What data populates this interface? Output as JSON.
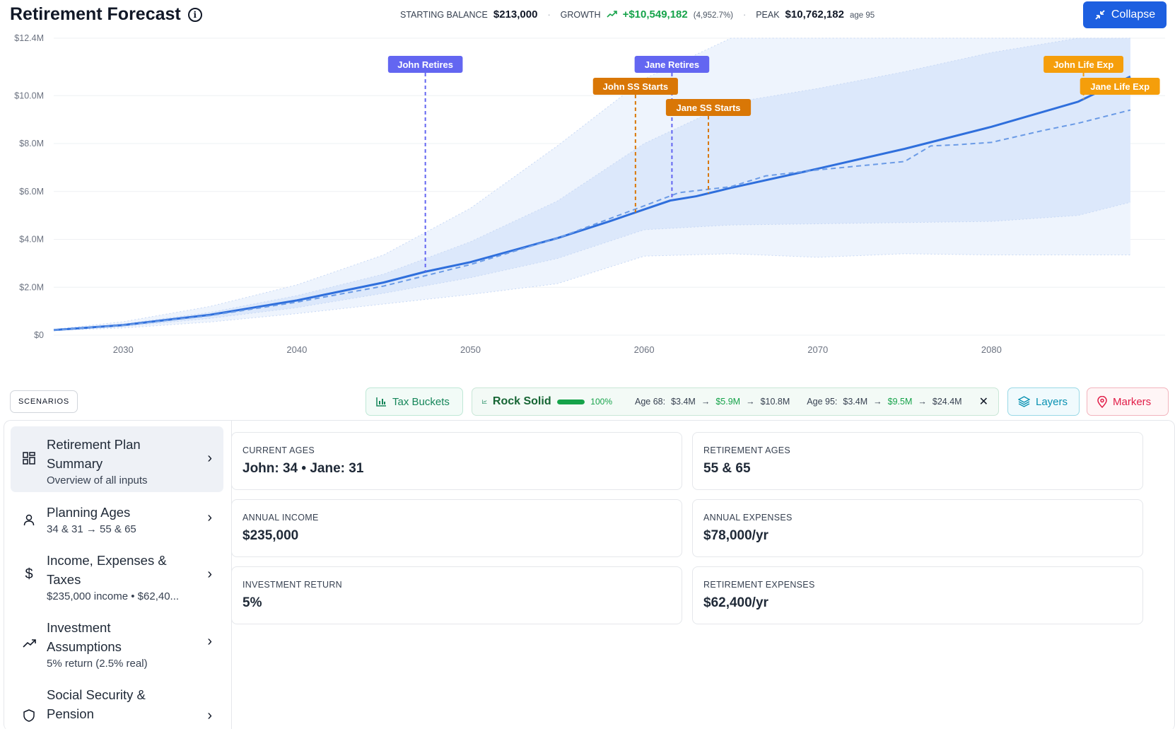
{
  "header": {
    "title": "Retirement Forecast",
    "starting_balance_label": "STARTING BALANCE",
    "starting_balance": "$213,000",
    "growth_label": "GROWTH",
    "growth_value": "+$10,549,182",
    "growth_pct": "(4,952.7%)",
    "peak_label": "PEAK",
    "peak_value": "$10,762,182",
    "peak_age": "age 95",
    "collapse_label": "Collapse"
  },
  "colors": {
    "accent": "#1d5fe0",
    "main_line": "#2f6fdc",
    "band_outer": "#eef4fd",
    "band_inner": "#dce8fb",
    "retire_marker": "#6366f1",
    "ss_marker": "#d97706",
    "life_marker": "#f59e0b",
    "green": "#16a34a"
  },
  "chart_data": {
    "type": "area",
    "ylim": [
      0,
      12400000
    ],
    "xlim": [
      2026,
      2090
    ],
    "y_ticks": [
      "$0",
      "$2.0M",
      "$4.0M",
      "$6.0M",
      "$8.0M",
      "$10.0M",
      "$12.4M"
    ],
    "y_tick_values": [
      0,
      2000000,
      4000000,
      6000000,
      8000000,
      10000000,
      12400000
    ],
    "x_ticks": [
      "2030",
      "2040",
      "2050",
      "2060",
      "2070",
      "2080"
    ],
    "x_tick_values": [
      2030,
      2040,
      2050,
      2060,
      2070,
      2080
    ],
    "series": [
      {
        "name": "",
        "style": "solid",
        "x": [
          2026,
          2030,
          2035,
          2040,
          2045,
          2047.4,
          2050,
          2055,
          2058,
          2060,
          2061.5,
          2063,
          2065,
          2070,
          2075,
          2080,
          2085,
          2088
        ],
        "values": [
          213000,
          420000,
          850000,
          1450000,
          2200000,
          2650000,
          3050000,
          4050000,
          4750000,
          5250000,
          5620000,
          5800000,
          6150000,
          6950000,
          7780000,
          8700000,
          9750000,
          10800000
        ]
      },
      {
        "name": "",
        "style": "dashed",
        "x": [
          2026,
          2030,
          2035,
          2040,
          2045,
          2050,
          2055,
          2060,
          2062,
          2065,
          2067,
          2070,
          2075,
          2076.5,
          2078,
          2080,
          2083,
          2085,
          2088
        ],
        "values": [
          213000,
          410000,
          820000,
          1380000,
          2050000,
          2950000,
          4050000,
          5400000,
          5950000,
          6200000,
          6650000,
          6900000,
          7250000,
          7900000,
          7950000,
          8050000,
          8550000,
          8850000,
          9400000
        ]
      }
    ],
    "bands": [
      {
        "name": "",
        "x": [
          2026,
          2030,
          2035,
          2040,
          2045,
          2050,
          2055,
          2060,
          2065,
          2070,
          2075,
          2080,
          2085,
          2088
        ],
        "upper": [
          240000,
          560000,
          1200000,
          2100000,
          3350000,
          5300000,
          7900000,
          10700000,
          12400000,
          12400000,
          12400000,
          12400000,
          12400000,
          12400000
        ],
        "lower": [
          200000,
          300000,
          550000,
          900000,
          1300000,
          1700000,
          2150000,
          3300000,
          3400000,
          3250000,
          3400000,
          3350000,
          3350000,
          3350000
        ]
      },
      {
        "name": "",
        "x": [
          2026,
          2030,
          2035,
          2040,
          2045,
          2050,
          2055,
          2060,
          2065,
          2070,
          2075,
          2080,
          2085,
          2088
        ],
        "upper": [
          225000,
          470000,
          950000,
          1650000,
          2550000,
          3900000,
          5600000,
          8000000,
          9700000,
          10300000,
          11000000,
          11800000,
          12400000,
          12400000
        ],
        "lower": [
          205000,
          360000,
          700000,
          1150000,
          1750000,
          2400000,
          3200000,
          4400000,
          4600000,
          4650000,
          4700000,
          4750000,
          5000000,
          5550000
        ]
      }
    ],
    "markers": [
      {
        "label": "John Retires",
        "year": 2047.4,
        "row": 0,
        "kind": "retire"
      },
      {
        "label": "Jane Retires",
        "year": 2061.6,
        "row": 0,
        "kind": "retire"
      },
      {
        "label": "John SS Starts",
        "year": 2059.5,
        "row": 1,
        "kind": "ss"
      },
      {
        "label": "Jane SS Starts",
        "year": 2063.7,
        "row": 2,
        "kind": "ss"
      },
      {
        "label": "John Life Exp",
        "year": 2085.3,
        "row": 0,
        "kind": "life"
      },
      {
        "label": "Jane Life Exp",
        "year": 2087.4,
        "row": 1,
        "kind": "life"
      }
    ]
  },
  "toolbar": {
    "scenarios_label": "SCENARIOS",
    "tax_buckets_label": "Tax Buckets",
    "scenario_name": "Rock Solid",
    "scenario_progress": 100,
    "scenario_pct_label": "100%",
    "age68_label": "Age 68:",
    "age68_v1": "$3.4M",
    "age68_v2": "$5.9M",
    "age68_v3": "$10.8M",
    "age95_label": "Age 95:",
    "age95_v1": "$3.4M",
    "age95_v2": "$9.5M",
    "age95_v3": "$24.4M",
    "arrow": "→",
    "layers_label": "Layers",
    "markers_label": "Markers"
  },
  "sidebar": {
    "items": [
      {
        "title": "Retirement Plan Summary",
        "sub": "Overview of all inputs",
        "icon": "grid-icon"
      },
      {
        "title": "Planning Ages",
        "sub": "34 & 31 → 55 & 65",
        "icon": "user-icon"
      },
      {
        "title": "Income, Expenses & Taxes",
        "sub": "$235,000 income • $62,40...",
        "icon": "dollar-icon"
      },
      {
        "title": "Investment Assumptions",
        "sub": "5% return (2.5% real)",
        "icon": "trend-up-icon"
      },
      {
        "title": "Social Security & Pension",
        "sub": "",
        "icon": "shield-icon"
      }
    ]
  },
  "summary": {
    "cards": [
      {
        "label": "CURRENT AGES",
        "value": "John: 34 • Jane: 31"
      },
      {
        "label": "RETIREMENT AGES",
        "value": "55 & 65"
      },
      {
        "label": "ANNUAL INCOME",
        "value": "$235,000"
      },
      {
        "label": "ANNUAL EXPENSES",
        "value": "$78,000/yr"
      },
      {
        "label": "INVESTMENT RETURN",
        "value": "5%"
      },
      {
        "label": "RETIREMENT EXPENSES",
        "value": "$62,400/yr"
      }
    ]
  }
}
